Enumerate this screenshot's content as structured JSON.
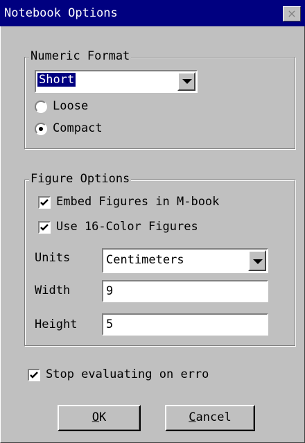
{
  "window": {
    "title": "Notebook Options",
    "close_glyph": "×"
  },
  "numeric_format": {
    "legend": "Numeric Format",
    "selected": "Short",
    "options": [
      {
        "label": "Loose",
        "checked": false
      },
      {
        "label": "Compact",
        "checked": true
      }
    ]
  },
  "figure_options": {
    "legend": "Figure Options",
    "embed_figures": {
      "label": "Embed Figures in M-book",
      "checked": true
    },
    "use_16_color": {
      "label": "Use 16-Color Figures",
      "checked": true
    },
    "units": {
      "label": "Units",
      "value": "Centimeters"
    },
    "width": {
      "label": "Width",
      "value": "9"
    },
    "height": {
      "label": "Height",
      "value": "5"
    }
  },
  "stop_on_error": {
    "label": "Stop evaluating on erro",
    "checked": true
  },
  "buttons": {
    "ok": {
      "mnemonic": "O",
      "rest": "K"
    },
    "cancel": {
      "mnemonic": "C",
      "rest": "ancel"
    }
  },
  "icons": [
    "close-icon",
    "dropdown-arrow-icon",
    "checkmark-icon",
    "radio-dot-icon"
  ]
}
